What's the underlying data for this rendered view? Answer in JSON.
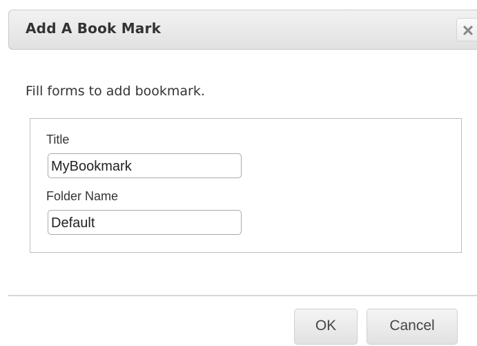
{
  "dialog": {
    "title": "Add A Book Mark",
    "close_icon": "close-icon",
    "instructions": "Fill forms to add bookmark.",
    "fields": [
      {
        "label": "Title",
        "value": "MyBookmark"
      },
      {
        "label": "Folder Name",
        "value": "Default"
      }
    ],
    "buttons": {
      "ok_label": "OK",
      "cancel_label": "Cancel"
    }
  },
  "colors": {
    "titlebar_bg": "#e8e8e8",
    "text": "#333333",
    "border": "#bdbdbd"
  }
}
